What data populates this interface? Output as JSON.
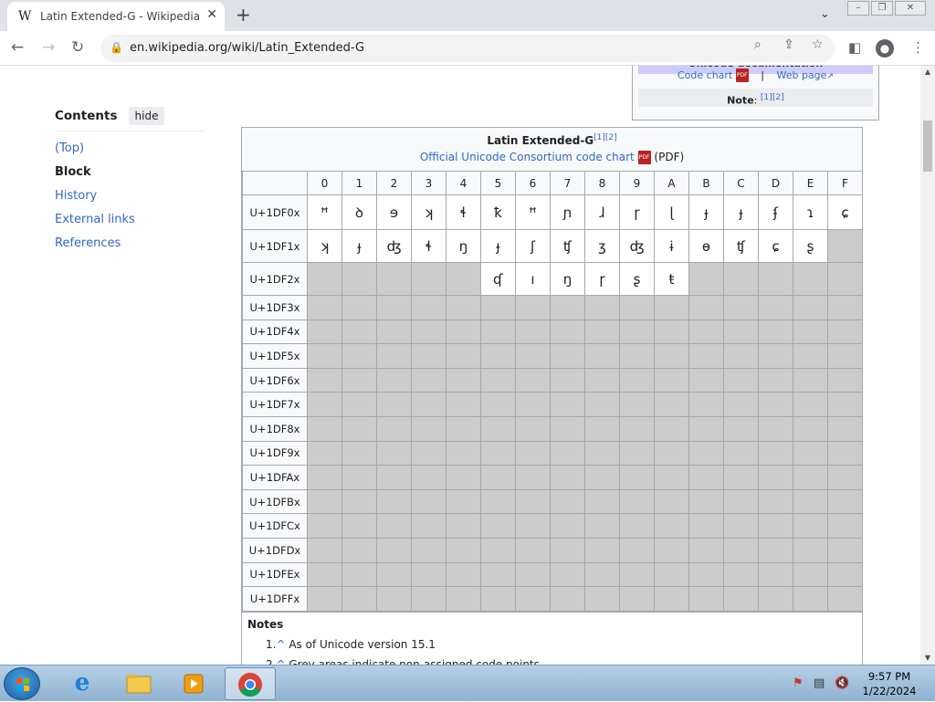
{
  "browser": {
    "tab_title": "Latin Extended-G - Wikipedia",
    "tab_favicon": "W",
    "url": "en.wikipedia.org/wiki/Latin_Extended-G"
  },
  "toc": {
    "title": "Contents",
    "hide_label": "hide",
    "items": [
      {
        "label": "(Top)",
        "active": false
      },
      {
        "label": "Block",
        "active": true
      },
      {
        "label": "History",
        "active": false
      },
      {
        "label": "External links",
        "active": false
      },
      {
        "label": "References",
        "active": false
      }
    ]
  },
  "infobox": {
    "header_text": "Unicode documentation",
    "code_chart_label": "Code chart",
    "separator": "|",
    "web_page_label": "Web page",
    "note_label": "Note",
    "note_refs": "[1][2]"
  },
  "chart": {
    "title": "Latin Extended-G",
    "title_refs": "[1][2]",
    "official_link": "Official Unicode Consortium code chart",
    "pdf_suffix": "(PDF)",
    "columns": [
      "0",
      "1",
      "2",
      "3",
      "4",
      "5",
      "6",
      "7",
      "8",
      "9",
      "A",
      "B",
      "C",
      "D",
      "E",
      "F"
    ],
    "rows": [
      {
        "label": "U+1DF0x",
        "cells": [
          "ꟸ",
          "ꝺ",
          "ɘ",
          "ʞ",
          "ɬ",
          "ꝁ",
          "ꟸ",
          "ɲ",
          "ɺ",
          "ɼ",
          "ɭ",
          "ɟ",
          "ɟ",
          "ʄ",
          "ɿ",
          "ɕ"
        ]
      },
      {
        "label": "U+1DF1x",
        "cells": [
          "ʞ",
          "ɟ",
          "ʤ",
          "ɬ",
          "ŋ",
          "ɟ",
          "ʃ",
          "ʧ",
          "ʒ",
          "ʤ",
          "ɨ",
          "ɵ",
          "ʧ",
          "ɕ",
          "ʂ",
          ""
        ]
      },
      {
        "label": "U+1DF2x",
        "cells": [
          "",
          "",
          "",
          "",
          "",
          "ʠ",
          "ı",
          "ŋ",
          "ɼ",
          "ʂ",
          "ŧ",
          "",
          "",
          "",
          "",
          ""
        ]
      },
      {
        "label": "U+1DF3x",
        "cells": [
          "",
          "",
          "",
          "",
          "",
          "",
          "",
          "",
          "",
          "",
          "",
          "",
          "",
          "",
          "",
          ""
        ]
      },
      {
        "label": "U+1DF4x",
        "cells": [
          "",
          "",
          "",
          "",
          "",
          "",
          "",
          "",
          "",
          "",
          "",
          "",
          "",
          "",
          "",
          ""
        ]
      },
      {
        "label": "U+1DF5x",
        "cells": [
          "",
          "",
          "",
          "",
          "",
          "",
          "",
          "",
          "",
          "",
          "",
          "",
          "",
          "",
          "",
          ""
        ]
      },
      {
        "label": "U+1DF6x",
        "cells": [
          "",
          "",
          "",
          "",
          "",
          "",
          "",
          "",
          "",
          "",
          "",
          "",
          "",
          "",
          "",
          ""
        ]
      },
      {
        "label": "U+1DF7x",
        "cells": [
          "",
          "",
          "",
          "",
          "",
          "",
          "",
          "",
          "",
          "",
          "",
          "",
          "",
          "",
          "",
          ""
        ]
      },
      {
        "label": "U+1DF8x",
        "cells": [
          "",
          "",
          "",
          "",
          "",
          "",
          "",
          "",
          "",
          "",
          "",
          "",
          "",
          "",
          "",
          ""
        ]
      },
      {
        "label": "U+1DF9x",
        "cells": [
          "",
          "",
          "",
          "",
          "",
          "",
          "",
          "",
          "",
          "",
          "",
          "",
          "",
          "",
          "",
          ""
        ]
      },
      {
        "label": "U+1DFAx",
        "cells": [
          "",
          "",
          "",
          "",
          "",
          "",
          "",
          "",
          "",
          "",
          "",
          "",
          "",
          "",
          "",
          ""
        ]
      },
      {
        "label": "U+1DFBx",
        "cells": [
          "",
          "",
          "",
          "",
          "",
          "",
          "",
          "",
          "",
          "",
          "",
          "",
          "",
          "",
          "",
          ""
        ]
      },
      {
        "label": "U+1DFCx",
        "cells": [
          "",
          "",
          "",
          "",
          "",
          "",
          "",
          "",
          "",
          "",
          "",
          "",
          "",
          "",
          "",
          ""
        ]
      },
      {
        "label": "U+1DFDx",
        "cells": [
          "",
          "",
          "",
          "",
          "",
          "",
          "",
          "",
          "",
          "",
          "",
          "",
          "",
          "",
          "",
          ""
        ]
      },
      {
        "label": "U+1DFEx",
        "cells": [
          "",
          "",
          "",
          "",
          "",
          "",
          "",
          "",
          "",
          "",
          "",
          "",
          "",
          "",
          "",
          ""
        ]
      },
      {
        "label": "U+1DFFx",
        "cells": [
          "",
          "",
          "",
          "",
          "",
          "",
          "",
          "",
          "",
          "",
          "",
          "",
          "",
          "",
          "",
          ""
        ]
      }
    ],
    "notes_heading": "Notes",
    "notes": [
      {
        "num": "1.",
        "text": "As of Unicode version 15.1"
      },
      {
        "num": "2.",
        "text": "Grey areas indicate non-assigned code points"
      }
    ]
  },
  "taskbar": {
    "time": "9:57 PM",
    "date": "1/22/2024",
    "apps": [
      "internet-explorer",
      "file-explorer",
      "media-player",
      "chrome"
    ]
  },
  "colors": {
    "link": "#3366cc",
    "grey_cell": "#cccccc",
    "infobox_header": "#ccccff"
  }
}
